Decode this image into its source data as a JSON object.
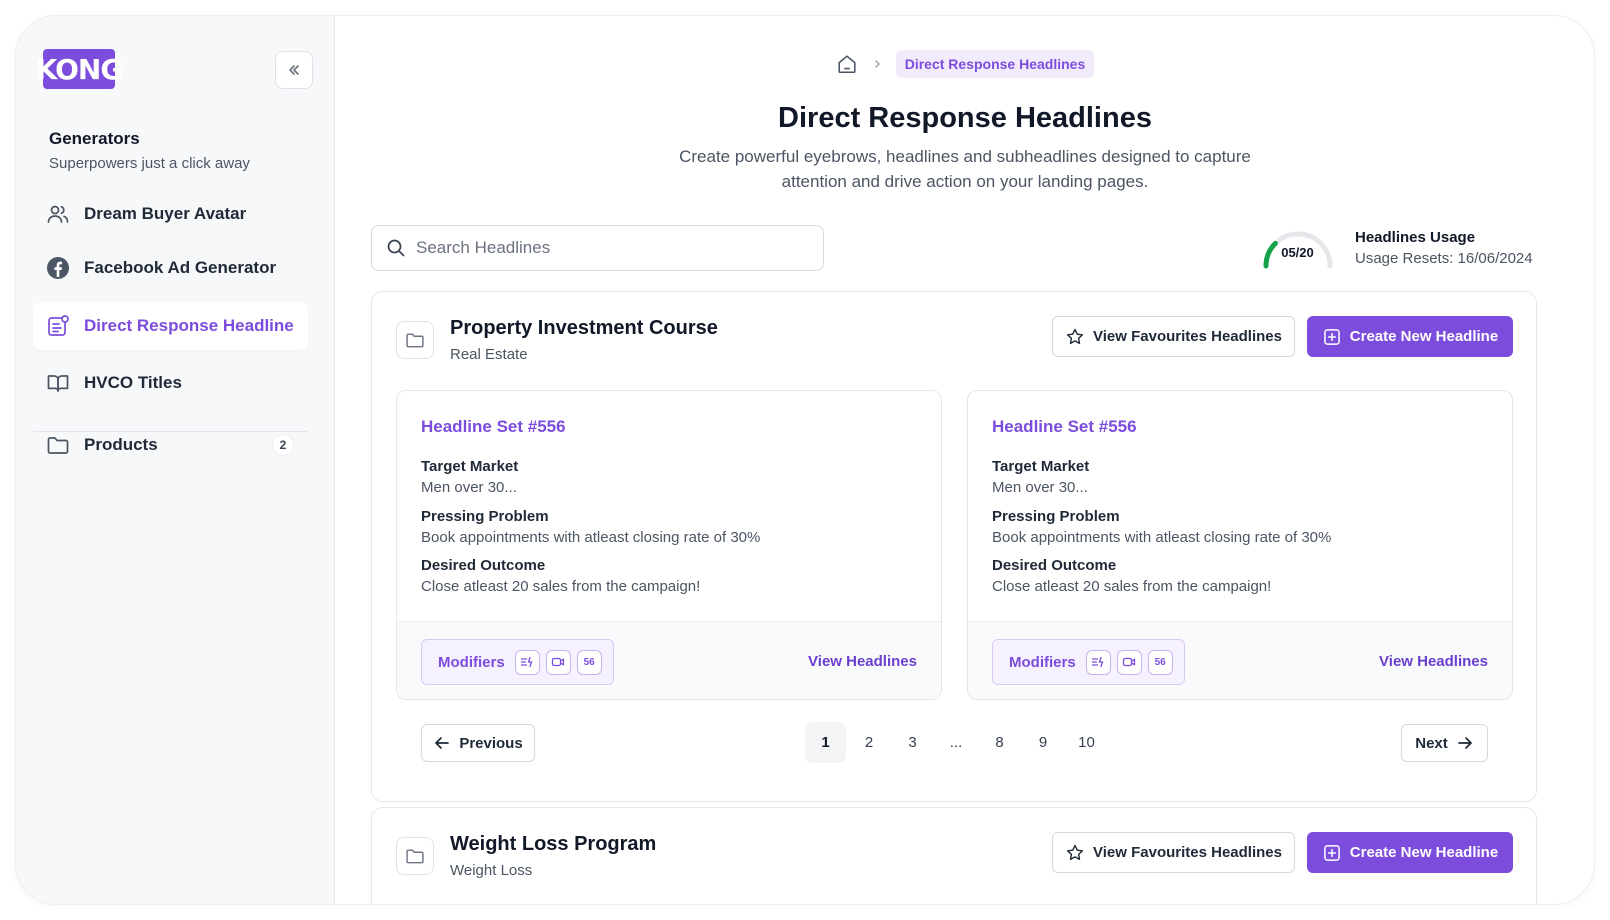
{
  "sidebar": {
    "logo_text": "KONG",
    "section_title": "Generators",
    "section_subtitle": "Superpowers just a click away",
    "items": [
      {
        "label": "Dream Buyer Avatar",
        "icon": "users-icon"
      },
      {
        "label": "Facebook Ad Generator",
        "icon": "facebook-icon"
      },
      {
        "label": "Direct Response Headline",
        "icon": "headline-icon",
        "active": true
      },
      {
        "label": "HVCO Titles",
        "icon": "book-icon"
      },
      {
        "label": "Products",
        "icon": "folder-icon",
        "count": "2"
      }
    ]
  },
  "breadcrumb": {
    "current": "Direct Response Headlines"
  },
  "header": {
    "title": "Direct Response Headlines",
    "description": "Create powerful eyebrows, headlines and subheadlines designed to capture attention and drive action on your landing pages."
  },
  "search": {
    "placeholder": "Search Headlines"
  },
  "usage": {
    "value": "05/20",
    "used": 5,
    "limit": 20,
    "title": "Headlines Usage",
    "subtitle": "Usage Resets: 16/06/2024",
    "color": "#16a34a"
  },
  "courses": [
    {
      "name": "Property Investment Course",
      "category": "Real Estate",
      "fav_label": "View Favourites Headlines",
      "create_label": "Create New Headline",
      "sets": [
        {
          "title": "Headline Set #556",
          "target_label": "Target Market",
          "target_value": "Men over 30...",
          "problem_label": "Pressing Problem",
          "problem_value": "Book appointments with atleast closing rate of 30%",
          "outcome_label": "Desired Outcome",
          "outcome_value": "Close atleast 20 sales from the campaign!",
          "modifiers_label": "Modifiers",
          "modifier_count": "56",
          "view_label": "View Headlines"
        },
        {
          "title": "Headline Set #556",
          "target_label": "Target Market",
          "target_value": "Men over 30...",
          "problem_label": "Pressing Problem",
          "problem_value": "Book appointments with atleast closing rate of 30%",
          "outcome_label": "Desired Outcome",
          "outcome_value": "Close atleast 20 sales from the campaign!",
          "modifiers_label": "Modifiers",
          "modifier_count": "56",
          "view_label": "View Headlines"
        }
      ],
      "pagination": {
        "prev": "Previous",
        "next": "Next",
        "pages": [
          "1",
          "2",
          "3",
          "...",
          "8",
          "9",
          "10"
        ],
        "current": "1"
      }
    },
    {
      "name": "Weight Loss Program",
      "category": "Weight Loss",
      "fav_label": "View Favourites Headlines",
      "create_label": "Create New Headline"
    }
  ],
  "colors": {
    "accent": "#7c4ddd",
    "accent_light": "#f1ebfc"
  }
}
